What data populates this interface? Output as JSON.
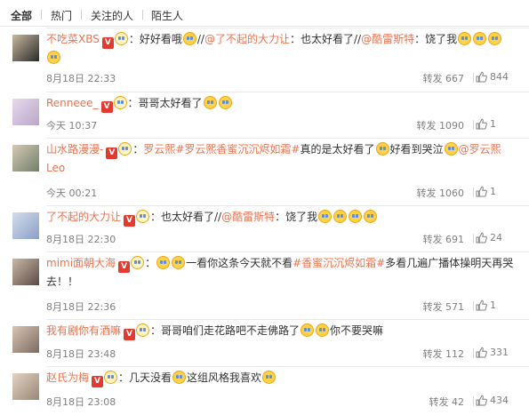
{
  "tabs": [
    "全部",
    "热门",
    "关注的人",
    "陌生人"
  ],
  "reply_label": "转发",
  "comments": [
    {
      "user": "不吃菜XBS",
      "segments": [
        {
          "t": "：好好看哦",
          "k": "text"
        },
        {
          "k": "emoji"
        },
        {
          "t": "//",
          "k": "text"
        },
        {
          "t": "@了不起的大力让",
          "k": "link"
        },
        {
          "t": "：也太好看了//",
          "k": "text"
        },
        {
          "t": "@酷雷斯特",
          "k": "link"
        },
        {
          "t": "：饶了我",
          "k": "text"
        }
      ],
      "emojis_tail": 4,
      "time": "8月18日 22:33",
      "reposts": "转发 667",
      "likes": "844"
    },
    {
      "user": "Renneee_",
      "segments": [
        {
          "t": "：哥哥太好看了",
          "k": "text"
        }
      ],
      "emojis_tail": 2,
      "time": "今天 10:37",
      "reposts": "转发 1090",
      "likes": "1"
    },
    {
      "user": "山水路漫漫-",
      "segments": [
        {
          "t": "：",
          "k": "text"
        },
        {
          "t": "罗云熙",
          "k": "link"
        },
        {
          "t": "#罗云熙香蜜沉沉烬如霜#",
          "k": "link"
        },
        {
          "t": "真的是太好看了",
          "k": "text"
        },
        {
          "k": "emoji"
        },
        {
          "t": "好看到哭泣",
          "k": "text"
        },
        {
          "k": "emoji"
        },
        {
          "t": "@罗云熙Leo",
          "k": "link"
        }
      ],
      "emojis_tail": 0,
      "time": "今天 00:21",
      "reposts": "转发 1060",
      "likes": "1"
    },
    {
      "user": "了不起的大力让",
      "segments": [
        {
          "t": "：也太好看了//",
          "k": "text"
        },
        {
          "t": "@酷雷斯特",
          "k": "link"
        },
        {
          "t": "：饶了我",
          "k": "text"
        }
      ],
      "emojis_tail": 4,
      "time": "8月18日 22:30",
      "reposts": "转发 691",
      "likes": "24"
    },
    {
      "user": "mimi面朝大海",
      "segments": [
        {
          "t": "：",
          "k": "text"
        },
        {
          "k": "emoji"
        },
        {
          "k": "emoji"
        },
        {
          "t": "一看你这条今天就不看",
          "k": "text"
        },
        {
          "t": "#香蜜沉沉烬如霜#",
          "k": "link"
        },
        {
          "t": "多看几遍广播体操明天再哭去！！",
          "k": "text"
        }
      ],
      "emojis_tail": 0,
      "time": "8月18日 22:36",
      "reposts": "转发 571",
      "likes": "1"
    },
    {
      "user": "我有剧你有酒嘛",
      "segments": [
        {
          "t": "：哥哥咱们走花路吧不走佛路了",
          "k": "text"
        },
        {
          "k": "emoji"
        },
        {
          "k": "emoji"
        },
        {
          "t": "你不要哭嘛",
          "k": "text"
        }
      ],
      "emojis_tail": 0,
      "time": "8月18日 23:48",
      "reposts": "转发 112",
      "likes": "331"
    },
    {
      "user": "赵氏为梅",
      "segments": [
        {
          "t": "：几天没看",
          "k": "text"
        },
        {
          "k": "emoji"
        },
        {
          "t": "这组风格我喜欢",
          "k": "text"
        },
        {
          "k": "emoji"
        }
      ],
      "emojis_tail": 0,
      "time": "8月18日 23:08",
      "reposts": "转发 42",
      "likes": "434"
    }
  ]
}
